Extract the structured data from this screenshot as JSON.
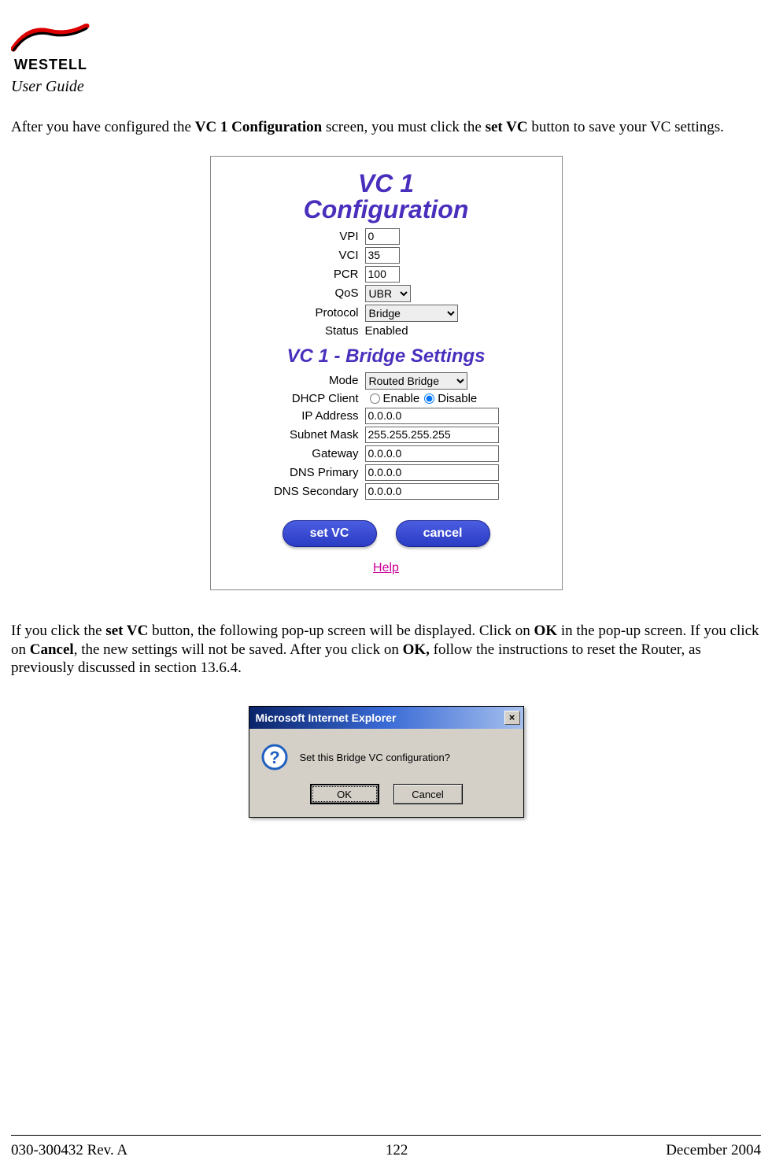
{
  "header": {
    "brand": "WESTELL",
    "doc_label": "User Guide"
  },
  "para1": {
    "pre": "After you have configured the ",
    "b1": "VC 1 Configuration",
    "mid": " screen, you must click the ",
    "b2": "set VC",
    "post": " button to save your VC settings."
  },
  "panel": {
    "title_line1": "VC 1",
    "title_line2": "Configuration",
    "vpi_label": "VPI",
    "vpi_value": "0",
    "vci_label": "VCI",
    "vci_value": "35",
    "pcr_label": "PCR",
    "pcr_value": "100",
    "qos_label": "QoS",
    "qos_value": "UBR",
    "protocol_label": "Protocol",
    "protocol_value": "Bridge",
    "status_label": "Status",
    "status_value": "Enabled",
    "subtitle": "VC 1 - Bridge Settings",
    "mode_label": "Mode",
    "mode_value": "Routed Bridge",
    "dhcp_label": "DHCP Client",
    "dhcp_enable": "Enable",
    "dhcp_disable": "Disable",
    "ip_label": "IP Address",
    "ip_value": "0.0.0.0",
    "subnet_label": "Subnet Mask",
    "subnet_value": "255.255.255.255",
    "gateway_label": "Gateway",
    "gateway_value": "0.0.0.0",
    "dns1_label": "DNS Primary",
    "dns1_value": "0.0.0.0",
    "dns2_label": "DNS Secondary",
    "dns2_value": "0.0.0.0",
    "btn_set": "set VC",
    "btn_cancel": "cancel",
    "help": "Help"
  },
  "para2": {
    "p1": "If you click the ",
    "b1": "set VC",
    "p2": " button, the following pop-up screen will be displayed. Click on ",
    "b2": "OK",
    "p3": " in the pop-up screen. If you click on ",
    "b3": "Cancel",
    "p4": ", the new settings will not be saved. After you click on ",
    "b4": "OK,",
    "p5": " follow the instructions to reset the Router, as previously discussed in section 13.6.4."
  },
  "dialog": {
    "title": "Microsoft Internet Explorer",
    "close": "×",
    "message": "Set this Bridge VC configuration?",
    "ok": "OK",
    "cancel": "Cancel"
  },
  "footer": {
    "left": "030-300432 Rev. A",
    "center": "122",
    "right": "December 2004"
  }
}
